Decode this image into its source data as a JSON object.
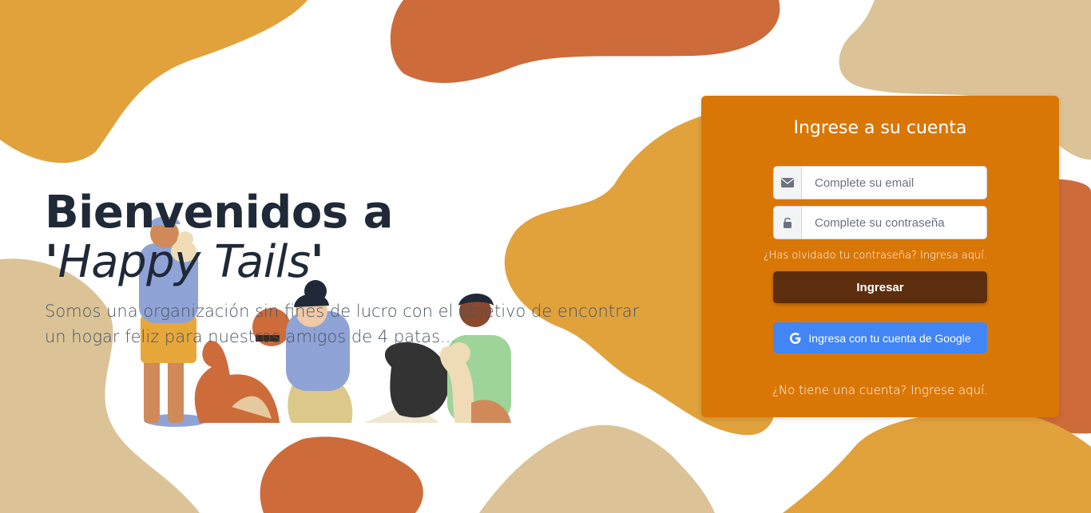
{
  "hero": {
    "title_prefix": "Bienvenidos a",
    "brand_open": "'",
    "brand_name": "Happy Tails",
    "brand_close": "'",
    "subtitle": "Somos una organización sin fines de lucro con el objetivo de encontrar un hogar feliz para nuestros amigos de 4 patas..."
  },
  "login": {
    "title": "Ingrese a su cuenta",
    "email_placeholder": "Complete su email",
    "password_placeholder": "Complete su contraseña",
    "forgot_link": "¿Has olvidado tu contraseña? Ingresa aquí.",
    "submit_label": "Ingresar",
    "google_label": "Ingresa con tu cuenta de Google",
    "register_link": "¿No tiene una cuenta? Ingrese aquí."
  },
  "icons": {
    "email": "envelope-icon",
    "password": "lock-icon",
    "google": "google-icon"
  },
  "colors": {
    "card_bg": "#d97706",
    "submit_bg": "#5c2e0e",
    "google_bg": "#4285f4",
    "blob_yellow": "#e1a23c",
    "blob_orange": "#cd6b3b",
    "blob_tan": "#dbc397",
    "title_text": "#1f2937"
  }
}
